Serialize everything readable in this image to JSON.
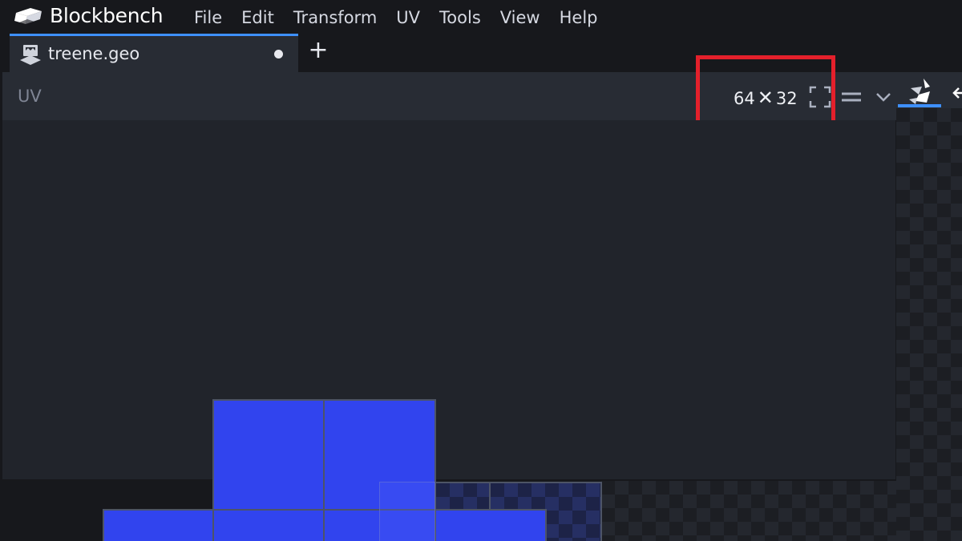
{
  "app": {
    "name": "Blockbench",
    "menu": [
      "File",
      "Edit",
      "Transform",
      "UV",
      "Tools",
      "View",
      "Help"
    ]
  },
  "tabs": [
    {
      "label": "treene.geo",
      "unsaved": true,
      "active": true
    }
  ],
  "uv_panel": {
    "title": "UV",
    "texture_width": "64",
    "times_symbol": "✕",
    "texture_height": "32"
  },
  "icons": {
    "logo": "blockbench-logo-icon",
    "tab": "model-file-icon",
    "new_tab": "+",
    "fullscreen": "fullscreen-icon",
    "menu": "menu-lines-icon",
    "chevron": "chevron-down-icon",
    "paint_tool": "paint-tool-icon",
    "move_tool": "move-tool-icon"
  },
  "colors": {
    "accent": "#3e90ff",
    "face_fill": "#3144ee",
    "highlight": "#e4202b"
  }
}
